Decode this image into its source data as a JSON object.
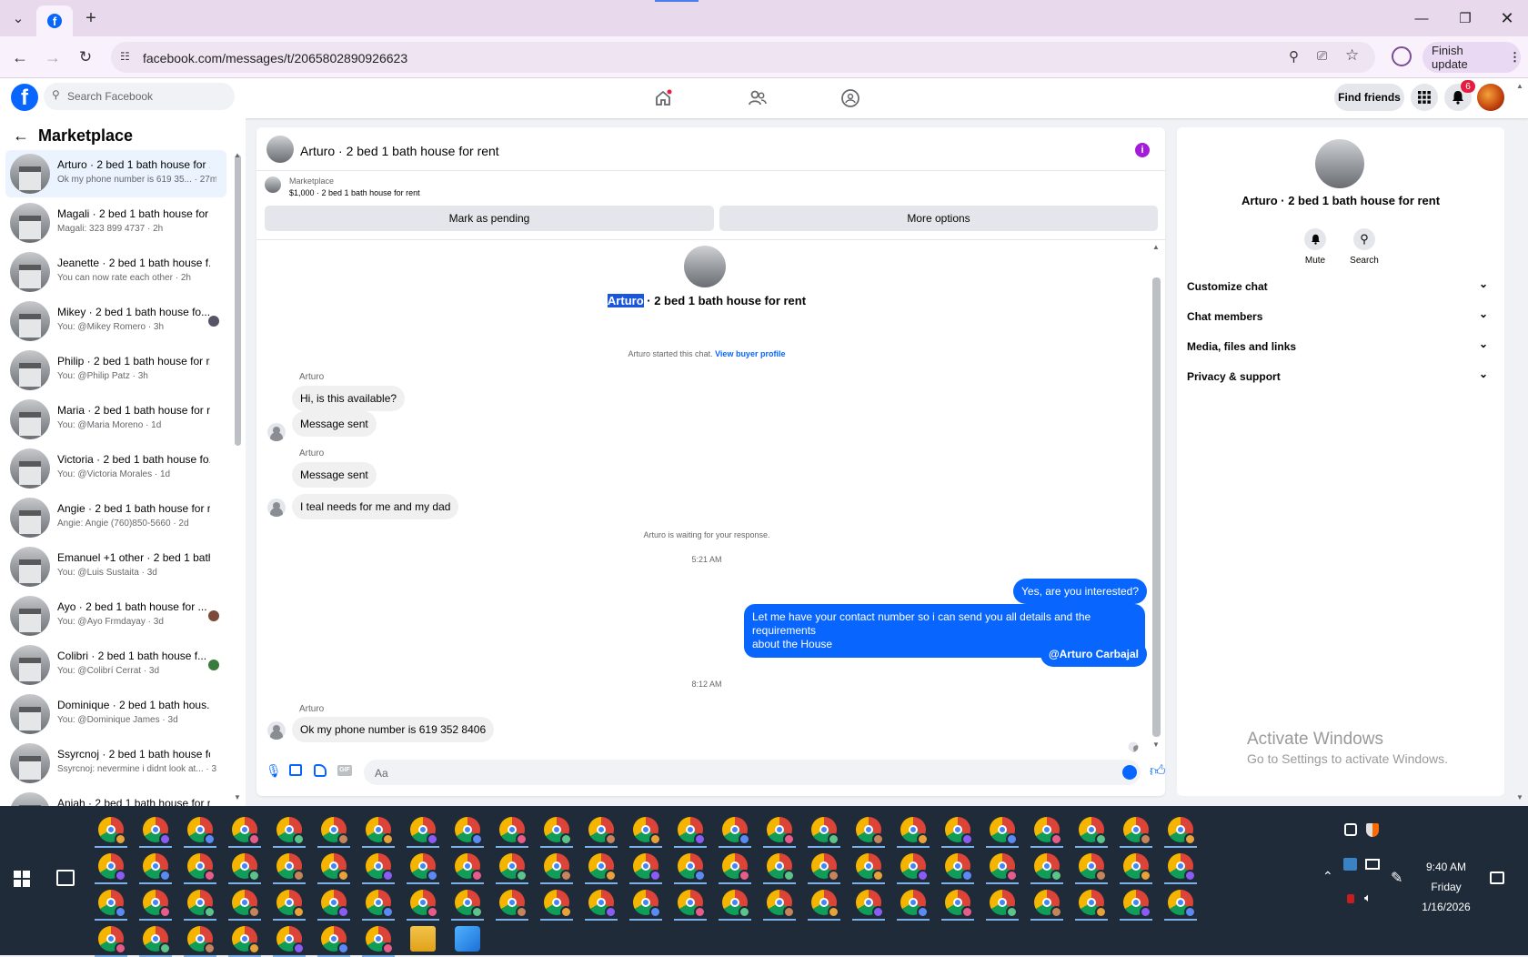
{
  "browser": {
    "url": "facebook.com/messages/t/2065802890926623",
    "finish_update": "Finish update",
    "window_controls": [
      "minimize-icon",
      "restore-icon",
      "close-icon"
    ]
  },
  "fb": {
    "search_placeholder": "Search Facebook",
    "find_friends": "Find friends",
    "notification_count": "6",
    "brand_color": "#0866ff"
  },
  "marketplace": {
    "title": "Marketplace",
    "conversations": [
      {
        "name": "Arturo · 2 bed 1 bath house for ...",
        "preview": "Ok my phone number is 619 35... · 27m",
        "selected": true
      },
      {
        "name": "Magali · 2 bed 1 bath house for ...",
        "preview": "Magali: 323 899 4737 · 2h"
      },
      {
        "name": "Jeanette · 2 bed 1 bath house f...",
        "preview": "You can now rate each other · 2h"
      },
      {
        "name": "Mikey · 2 bed 1 bath house fo...",
        "preview": "You: @Mikey Romero · 3h"
      },
      {
        "name": "Philip · 2 bed 1 bath house for r...",
        "preview": "You: @Philip Patz · 3h"
      },
      {
        "name": "Maria · 2 bed 1 bath house for r...",
        "preview": "You: @Maria Moreno · 1d"
      },
      {
        "name": "Victoria · 2 bed 1 bath house fo...",
        "preview": "You: @Victoria Morales · 1d"
      },
      {
        "name": "Angie · 2 bed 1 bath house for r...",
        "preview": "Angie: Angie (760)850-5660 · 2d"
      },
      {
        "name": "Emanuel +1 other · 2 bed 1 bath...",
        "preview": "You: @Luis Sustaita · 3d"
      },
      {
        "name": "Ayo · 2 bed 1 bath house for ...",
        "preview": "You: @Ayo Frmdayay · 3d"
      },
      {
        "name": "Colibri · 2 bed 1 bath house f...",
        "preview": "You: @Colibrí Cerrat · 3d"
      },
      {
        "name": "Dominique · 2 bed 1 bath hous...",
        "preview": "You: @Dominique James · 3d"
      },
      {
        "name": "Ssyrcnoj · 2 bed 1 bath house fo...",
        "preview": "Ssyrcnoj: nevermine i didnt look at... · 3d"
      },
      {
        "name": "Aniah · 2 bed 1 bath house for r...",
        "preview": ""
      }
    ]
  },
  "chat": {
    "title": "Arturo · 2 bed 1 bath house for rent",
    "listing_source": "Marketplace",
    "listing": "$1,000 · 2 bed 1 bath house for rent",
    "mark_pending": "Mark as pending",
    "more_options": "More options",
    "intro_name": "Arturo",
    "intro_rest": " · 2 bed 1 bath house for rent",
    "started": "Arturo started this chat.",
    "view_profile": "View buyer profile",
    "sender": "Arturo",
    "msg1": "Hi, is this available?",
    "msg2": "Message sent",
    "msg3": "Message sent",
    "msg4": "I teal needs for me and my dad",
    "waiting": "Arturo is waiting for your response.",
    "time1": "5:21 AM",
    "out1": "Yes, are you interested?",
    "out2a": "Let me have your contact number so i can send you all details and the requirements",
    "out2b": "about the House",
    "out3": "@Arturo Carbajal",
    "time2": "8:12 AM",
    "msg5": "Ok my phone number is 619 352 8406",
    "composer_placeholder": "Aa"
  },
  "details": {
    "title": "Arturo · 2 bed 1 bath house for rent",
    "mute": "Mute",
    "search": "Search",
    "sections": [
      "Customize chat",
      "Chat members",
      "Media, files and links",
      "Privacy & support"
    ]
  },
  "watermark": {
    "line1": "Activate Windows",
    "line2": "Go to Settings to activate Windows."
  },
  "taskbar": {
    "time": "9:40 AM",
    "day": "Friday",
    "date": "1/16/2026"
  }
}
